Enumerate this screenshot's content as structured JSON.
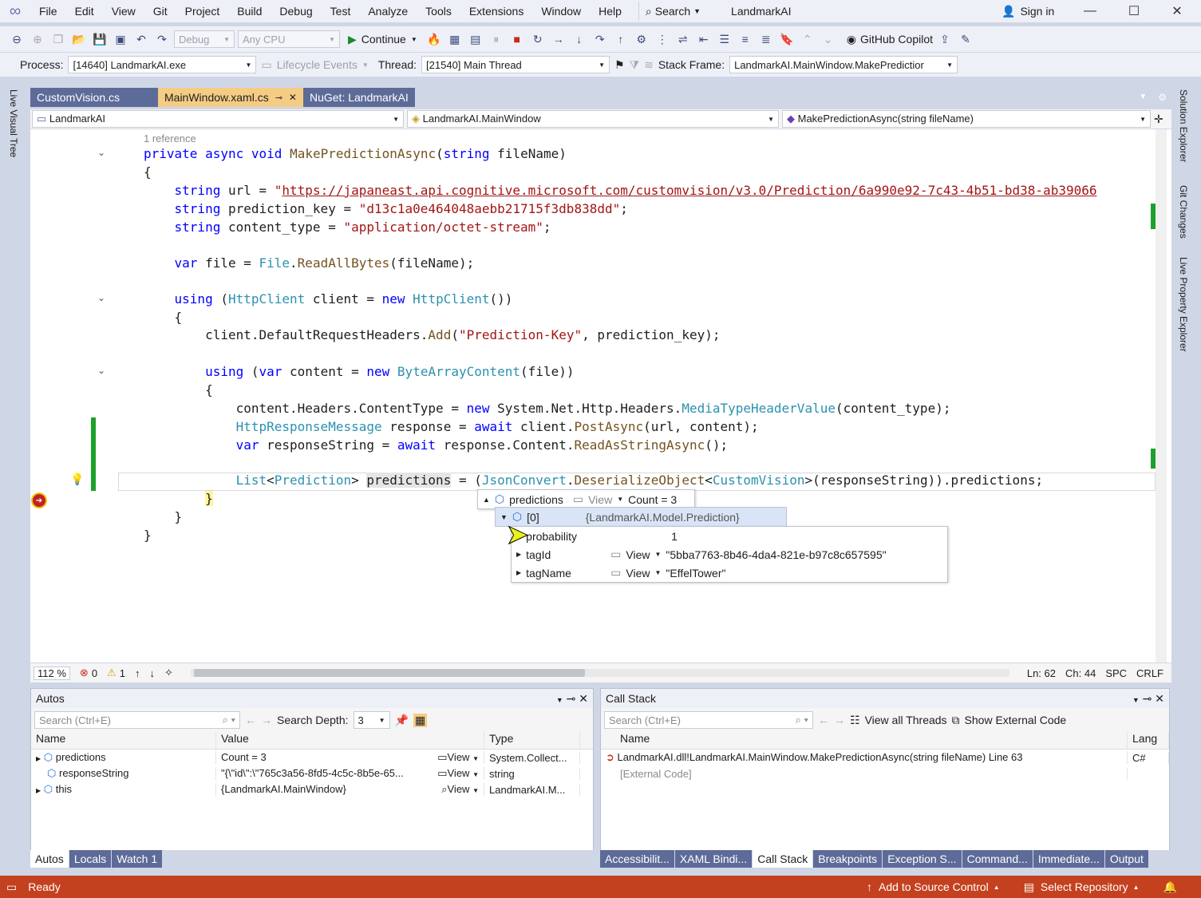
{
  "menu": {
    "items": [
      "File",
      "Edit",
      "View",
      "Git",
      "Project",
      "Build",
      "Debug",
      "Test",
      "Analyze",
      "Tools",
      "Extensions",
      "Window",
      "Help"
    ],
    "search_label": "Search",
    "solution_name": "LandmarkAI",
    "sign_in": "Sign in"
  },
  "toolbar": {
    "config": "Debug",
    "platform": "Any CPU",
    "continue_label": "Continue",
    "copilot_label": "GitHub Copilot"
  },
  "debug_location": {
    "process_label": "Process:",
    "process_value": "[14640] LandmarkAI.exe",
    "lifecycle_label": "Lifecycle Events",
    "thread_label": "Thread:",
    "thread_value": "[21540] Main Thread",
    "stack_frame_label": "Stack Frame:",
    "stack_frame_value": "LandmarkAI.MainWindow.MakePredictior"
  },
  "side_tabs": {
    "left": "Live Visual Tree",
    "right": [
      "Solution Explorer",
      "Git Changes",
      "Live Property Explorer"
    ]
  },
  "doc_tabs": [
    {
      "label": "CustomVision.cs",
      "state": "inactive"
    },
    {
      "label": "MainWindow.xaml.cs",
      "state": "active"
    },
    {
      "label": "NuGet: LandmarkAI",
      "state": "other"
    }
  ],
  "nav": {
    "project": "LandmarkAI",
    "type": "LandmarkAI.MainWindow",
    "member": "MakePredictionAsync(string fileName)"
  },
  "code": {
    "references": "1 reference"
  },
  "datatip": {
    "name": "predictions",
    "view": "View",
    "count": "Count = 3",
    "item_index": "[0]",
    "item_type": "{LandmarkAI.Model.Prediction}",
    "fields": [
      {
        "name": "probability",
        "view": "",
        "value": "1"
      },
      {
        "name": "tagId",
        "view": "View",
        "value": "\"5bba7763-8b46-4da4-821e-b97c8c657595\""
      },
      {
        "name": "tagName",
        "view": "View",
        "value": "\"EffelTower\""
      }
    ]
  },
  "editor_status": {
    "zoom": "112 %",
    "errors": "0",
    "warnings": "1",
    "line": "Ln: 62",
    "col": "Ch: 44",
    "spc": "SPC",
    "eol": "CRLF"
  },
  "autos": {
    "title": "Autos",
    "search_placeholder": "Search (Ctrl+E)",
    "depth_label": "Search Depth:",
    "depth_value": "3",
    "columns": [
      "Name",
      "Value",
      "Type"
    ],
    "rows": [
      {
        "name": "predictions",
        "value": "Count = 3",
        "view": "View",
        "type": "System.Collect..."
      },
      {
        "name": "responseString",
        "value": "\"{\\\"id\\\":\\\"765c3a56-8fd5-4c5c-8b5e-65...",
        "view": "View",
        "type": "string"
      },
      {
        "name": "this",
        "value": "{LandmarkAI.MainWindow}",
        "view": "View",
        "type": "LandmarkAI.M..."
      }
    ],
    "tabs": [
      "Autos",
      "Locals",
      "Watch 1"
    ]
  },
  "callstack": {
    "title": "Call Stack",
    "search_placeholder": "Search (Ctrl+E)",
    "view_threads": "View all Threads",
    "show_external": "Show External Code",
    "columns": [
      "Name",
      "Lang"
    ],
    "rows": [
      {
        "name": "LandmarkAI.dll!LandmarkAI.MainWindow.MakePredictionAsync(string fileName) Line 63",
        "lang": "C#"
      },
      {
        "name": "[External Code]",
        "lang": ""
      }
    ],
    "tabs": [
      "Accessibilit...",
      "XAML Bindi...",
      "Call Stack",
      "Breakpoints",
      "Exception S...",
      "Command...",
      "Immediate...",
      "Output"
    ]
  },
  "status": {
    "ready": "Ready",
    "source_control": "Add to Source Control",
    "repo": "Select Repository"
  },
  "colors": {
    "status_bar": "#c4411f",
    "active_tab": "#f5cc84",
    "keyword": "#0000ff",
    "type": "#2b91af",
    "string": "#a31515"
  }
}
